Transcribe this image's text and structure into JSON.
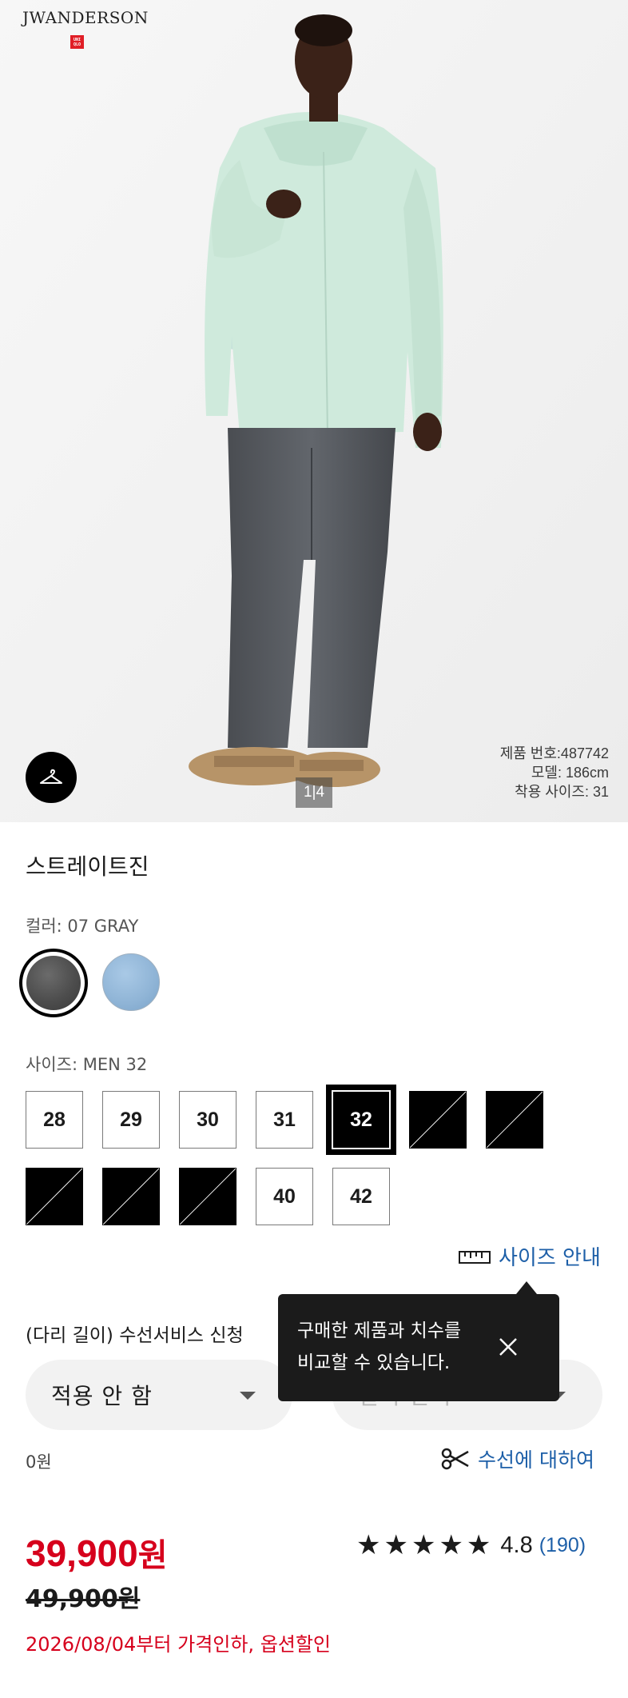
{
  "hero": {
    "brand_logo": "JWANDERSON",
    "uq_badge_top": "UNI",
    "uq_badge_bottom": "QLO",
    "image_counter": "1|4",
    "product_number": "제품 번호:487742",
    "model_height": "모델: 186cm",
    "wearing_size": "착용 사이즈: 31",
    "hanger_icon": "hanger-icon"
  },
  "product": {
    "title": "스트레이트진",
    "color_label": "컬러: 07 GRAY",
    "colors": [
      {
        "name": "07 GRAY",
        "hex": "#4d4d4d",
        "selected": true
      },
      {
        "name": "light-blue",
        "hex": "#8fb4d6",
        "selected": false
      }
    ],
    "size_label": "사이즈: MEN 32",
    "sizes": [
      {
        "label": "28",
        "state": "available"
      },
      {
        "label": "29",
        "state": "available"
      },
      {
        "label": "30",
        "state": "available"
      },
      {
        "label": "31",
        "state": "available"
      },
      {
        "label": "32",
        "state": "selected"
      },
      {
        "label": "",
        "state": "unavailable"
      },
      {
        "label": "",
        "state": "unavailable"
      },
      {
        "label": "",
        "state": "unavailable"
      },
      {
        "label": "",
        "state": "unavailable"
      },
      {
        "label": "",
        "state": "unavailable"
      },
      {
        "label": "40",
        "state": "available"
      },
      {
        "label": "42",
        "state": "available"
      }
    ],
    "size_guide_label": "사이즈 안내",
    "tooltip": {
      "line1": "구매한 제품과 치수를",
      "line2": "비교할 수 있습니다."
    },
    "alteration_label": "(다리 길이) 수선서비스 신청",
    "alteration_select": "적용 안 함",
    "length_select_placeholder": "길이 선택",
    "alteration_price": "0원",
    "alteration_info_link": "수선에 대하여",
    "price_number": "39,900",
    "price_unit": "원",
    "original_price": "49,900원",
    "rating_stars": "★★★★★",
    "rating_score": "4.8",
    "review_count": "(190)",
    "promo_text": "2026/08/04부터 가격인하,  옵션할인"
  },
  "colors": {
    "accent_blue": "#1d5fa8",
    "price_red": "#d6001c",
    "brand_red": "#e01e26"
  }
}
